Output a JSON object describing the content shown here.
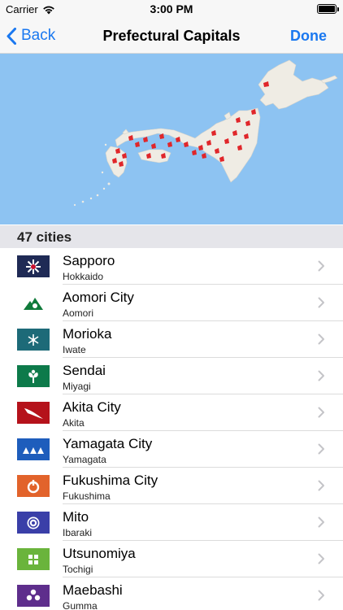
{
  "status": {
    "carrier": "Carrier",
    "time": "3:00 PM"
  },
  "nav": {
    "back_label": "Back",
    "title": "Prefectural Capitals",
    "done_label": "Done"
  },
  "section": {
    "header": "47 cities"
  },
  "colors": {
    "accent": "#1a78f0",
    "map_water": "#8dc3f2",
    "map_land": "#efece4",
    "marker": "#e0262a"
  },
  "cities": [
    {
      "name": "Sapporo",
      "prefecture": "Hokkaido",
      "flag_color": "#1f2a55",
      "flag_icon": "snowflake-star-emblem"
    },
    {
      "name": "Aomori City",
      "prefecture": "Aomori",
      "flag_color": "#ffffff",
      "flag_icon": "green-mountain-emblem"
    },
    {
      "name": "Morioka",
      "prefecture": "Iwate",
      "flag_color": "#1d6a78",
      "flag_icon": "leaf-star-emblem"
    },
    {
      "name": "Sendai",
      "prefecture": "Miyagi",
      "flag_color": "#0d7a4a",
      "flag_icon": "bush-clover-emblem"
    },
    {
      "name": "Akita City",
      "prefecture": "Akita",
      "flag_color": "#b5121b",
      "flag_icon": "swoosh-emblem"
    },
    {
      "name": "Yamagata City",
      "prefecture": "Yamagata",
      "flag_color": "#1e5dbc",
      "flag_icon": "mountain-peaks-emblem"
    },
    {
      "name": "Fukushima City",
      "prefecture": "Fukushima",
      "flag_color": "#e2632b",
      "flag_icon": "ring-emblem"
    },
    {
      "name": "Mito",
      "prefecture": "Ibaraki",
      "flag_color": "#3a3fa8",
      "flag_icon": "rose-emblem"
    },
    {
      "name": "Utsunomiya",
      "prefecture": "Tochigi",
      "flag_color": "#6ab43c",
      "flag_icon": "four-leaf-emblem"
    },
    {
      "name": "Maebashi",
      "prefecture": "Gumma",
      "flag_color": "#5e2e8c",
      "flag_icon": "flower-emblem"
    }
  ]
}
